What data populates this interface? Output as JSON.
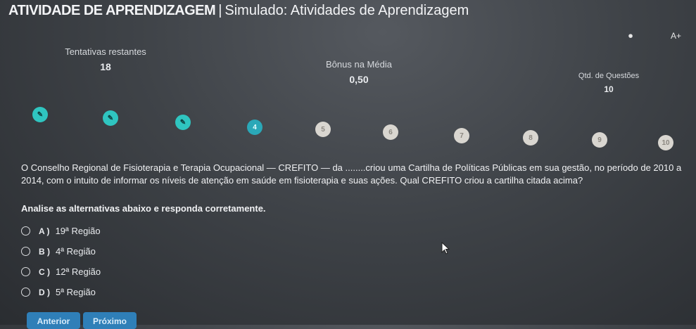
{
  "header": {
    "course": "ATIVIDADE DE APRENDIZAGEM",
    "separator": "|",
    "title": "Simulado: Atividades de Aprendizagem",
    "icon_right_1": "⏺",
    "icon_right_2": "A+"
  },
  "stats": {
    "attempts_label": "Tentativas restantes",
    "attempts_value": "18",
    "bonus_label": "Bônus na Média",
    "bonus_value": "0,50",
    "questions_label": "Qtd. de Questões",
    "questions_value": "10"
  },
  "steps": [
    {
      "label": "✎",
      "state": "done"
    },
    {
      "label": "✎",
      "state": "done"
    },
    {
      "label": "✎",
      "state": "done"
    },
    {
      "label": "4",
      "state": "current"
    },
    {
      "label": "5",
      "state": "todo"
    },
    {
      "label": "6",
      "state": "todo"
    },
    {
      "label": "7",
      "state": "todo"
    },
    {
      "label": "8",
      "state": "todo"
    },
    {
      "label": "9",
      "state": "todo"
    },
    {
      "label": "10",
      "state": "todo"
    }
  ],
  "question": {
    "text": "O Conselho Regional de Fisioterapia e Terapia Ocupacional — CREFITO — da ........criou uma Cartilha de Políticas Públicas em sua gestão, no período de 2010 a 2014, com o intuito de informar os níveis de atenção em saúde em fisioterapia e suas ações. Qual CREFITO criou a cartilha citada acima?",
    "instruction": "Analise as alternativas abaixo e responda corretamente."
  },
  "options": [
    {
      "letter": "A )",
      "text": "19ª Região"
    },
    {
      "letter": "B )",
      "text": "4ª Região"
    },
    {
      "letter": "C )",
      "text": "12ª Região"
    },
    {
      "letter": "D )",
      "text": "5ª Região"
    }
  ],
  "buttons": {
    "prev": "Anterior",
    "next": "Próximo"
  },
  "colors": {
    "done": "#2fc5c0",
    "current": "#2aa8b8",
    "todo": "#d9d6d0",
    "button": "#2f7fb8"
  }
}
